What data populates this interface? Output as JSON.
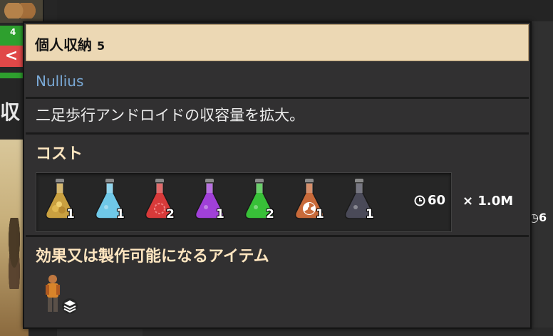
{
  "background": {
    "green_badge_label": "4",
    "back_button_label": "<",
    "heading_fragment": "収",
    "right_time_fragment": "6"
  },
  "tooltip": {
    "title": "個人収納",
    "level": "5",
    "mod_name": "Nullius",
    "description": "二足歩行アンドロイドの収容量を拡大。",
    "cost_heading": "コスト",
    "ingredients": [
      {
        "icon": "gold-ore-flask-icon",
        "count": "1",
        "color": "#c9a040"
      },
      {
        "icon": "cyan-flask-icon",
        "count": "1",
        "color": "#6fc8e8"
      },
      {
        "icon": "red-flask-icon",
        "count": "2",
        "color": "#d83a3a"
      },
      {
        "icon": "purple-flask-icon",
        "count": "1",
        "color": "#a040d8"
      },
      {
        "icon": "green-flask-icon",
        "count": "2",
        "color": "#38c038"
      },
      {
        "icon": "radiation-flask-icon",
        "count": "1",
        "color": "#c86a3a"
      },
      {
        "icon": "gray-flask-icon",
        "count": "1",
        "color": "#4a4a58"
      }
    ],
    "time": "60",
    "multiplier": "× 1.0M",
    "unlocks_heading": "効果又は製作可能になるアイテム",
    "unlocks": [
      {
        "icon": "android-unit-stack-icon"
      }
    ]
  }
}
